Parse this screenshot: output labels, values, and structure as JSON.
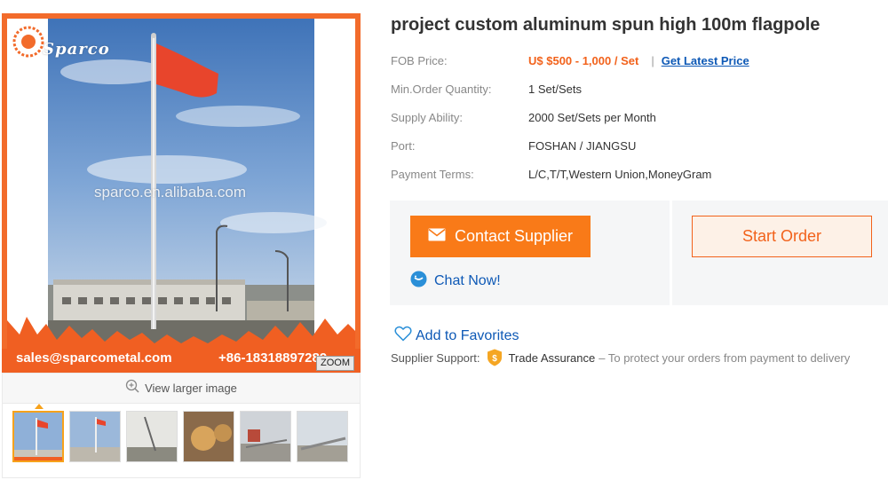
{
  "gallery": {
    "brand_watermark": "Sparco",
    "site_watermark": "sparco.en.alibaba.com",
    "contact_email": "sales@sparcometal.com",
    "contact_phone": "+86-18318897289",
    "zoom_label": "ZOOM",
    "view_larger_label": "View larger image",
    "thumbnail_count": 6,
    "active_thumbnail": 1,
    "brand_color": "#f26b2b",
    "icons": [
      "zoom-in-icon"
    ]
  },
  "product": {
    "title": "project custom aluminum spun high 100m flagpole",
    "attributes": {
      "fob": {
        "label": "FOB Price:",
        "price": "U$ $500 - 1,000 / Set",
        "separator": "|",
        "link": "Get Latest Price"
      },
      "moq": {
        "label": "Min.Order Quantity:",
        "value": "1 Set/Sets"
      },
      "supply": {
        "label": "Supply Ability:",
        "value": "2000 Set/Sets per Month"
      },
      "port": {
        "label": "Port:",
        "value": "FOSHAN / JIANGSU"
      },
      "payment": {
        "label": "Payment Terms:",
        "value": "L/C,T/T,Western Union,MoneyGram"
      }
    }
  },
  "actions": {
    "contact_supplier": "Contact Supplier",
    "start_order": "Start Order",
    "chat_now": "Chat Now!",
    "add_to_favorites": "Add to Favorites",
    "accent_color": "#f97a18",
    "link_color": "#0e59b6",
    "icons": [
      "envelope-icon",
      "chat-icon",
      "heart-icon",
      "shield-icon"
    ]
  },
  "support": {
    "label": "Supplier Support:",
    "trade_assurance": "Trade Assurance",
    "description": "– To protect your orders from payment to delivery"
  }
}
